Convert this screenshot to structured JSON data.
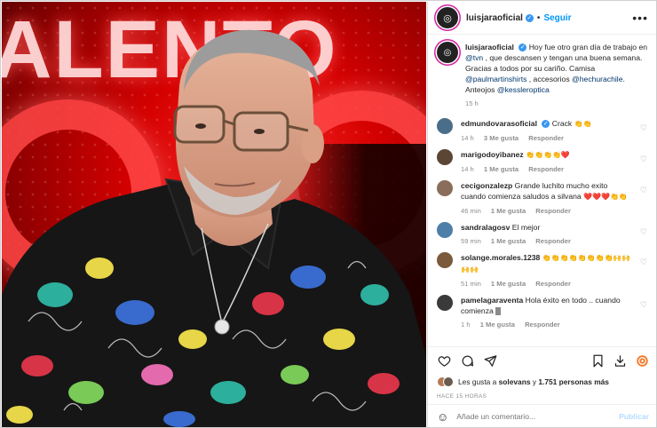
{
  "post": {
    "username": "luisjaraoficial",
    "verified_badge": "✓",
    "follow_label": "Seguir",
    "dot": "•",
    "more_icon": "more-horizontal-icon",
    "background_text": "ALENTO"
  },
  "caption": {
    "username": "luisjaraoficial",
    "text_parts": [
      "Hoy fue otro gran día de trabajo en ",
      "@tvn",
      " , que descansen y tengan una buena semana. Gracias a todos por su cariño. Camisa ",
      "@paulmartinshirts",
      " , accesorios ",
      "@hechurachile",
      ". Anteojos ",
      "@kessleroptica"
    ],
    "time": "15 h"
  },
  "comments": [
    {
      "username": "edmundovarasoficial",
      "verified": true,
      "text": "Crack ",
      "emoji": "👏👏",
      "time": "14 h",
      "likes": "3 Me gusta",
      "reply": "Responder",
      "avatar_color": "#4a6e8a"
    },
    {
      "username": "marigodoyibanez",
      "verified": false,
      "text": "",
      "emoji": "👏👏👏👏❤️",
      "time": "14 h",
      "likes": "1 Me gusta",
      "reply": "Responder",
      "avatar_color": "#5b4636"
    },
    {
      "username": "cecigonzalezp",
      "verified": false,
      "text": "Grande luchito mucho exito cuando comienza saludos a silvana ",
      "emoji": "❤️❤️❤️👏👏",
      "time": "46 min",
      "likes": "1 Me gusta",
      "reply": "Responder",
      "avatar_color": "#8a6d5a"
    },
    {
      "username": "sandralagosv",
      "verified": false,
      "text": "El mejor",
      "emoji": "",
      "time": "59 min",
      "likes": "1 Me gusta",
      "reply": "Responder",
      "avatar_color": "#4d7fa8"
    },
    {
      "username": "solange.morales.1238",
      "verified": false,
      "text": "",
      "emoji": "👏👏👏👏👏👏👏👏🙌🙌🙌🙌",
      "time": "51 min",
      "likes": "1 Me gusta",
      "reply": "Responder",
      "avatar_color": "#7a5a3a"
    },
    {
      "username": "pamelagaraventa",
      "verified": false,
      "text": "Hola éxito en todo .. cuando comienza ",
      "emoji": "",
      "time": "1 h",
      "likes": "1 Me gusta",
      "reply": "Responder",
      "avatar_color": "#3a3a3a"
    }
  ],
  "actions": {
    "likes_prefix": "Les gusta a ",
    "likes_user": "solevans",
    "likes_mid": " y ",
    "likes_count": "1.751 personas más",
    "time_ago": "HACE 15 HORAS"
  },
  "add_comment": {
    "placeholder": "Añade un comentario...",
    "post_label": "Publicar"
  },
  "colors": {
    "accent": "#0095f6",
    "verified": "#3897f0",
    "stage_red": "#d40000"
  }
}
